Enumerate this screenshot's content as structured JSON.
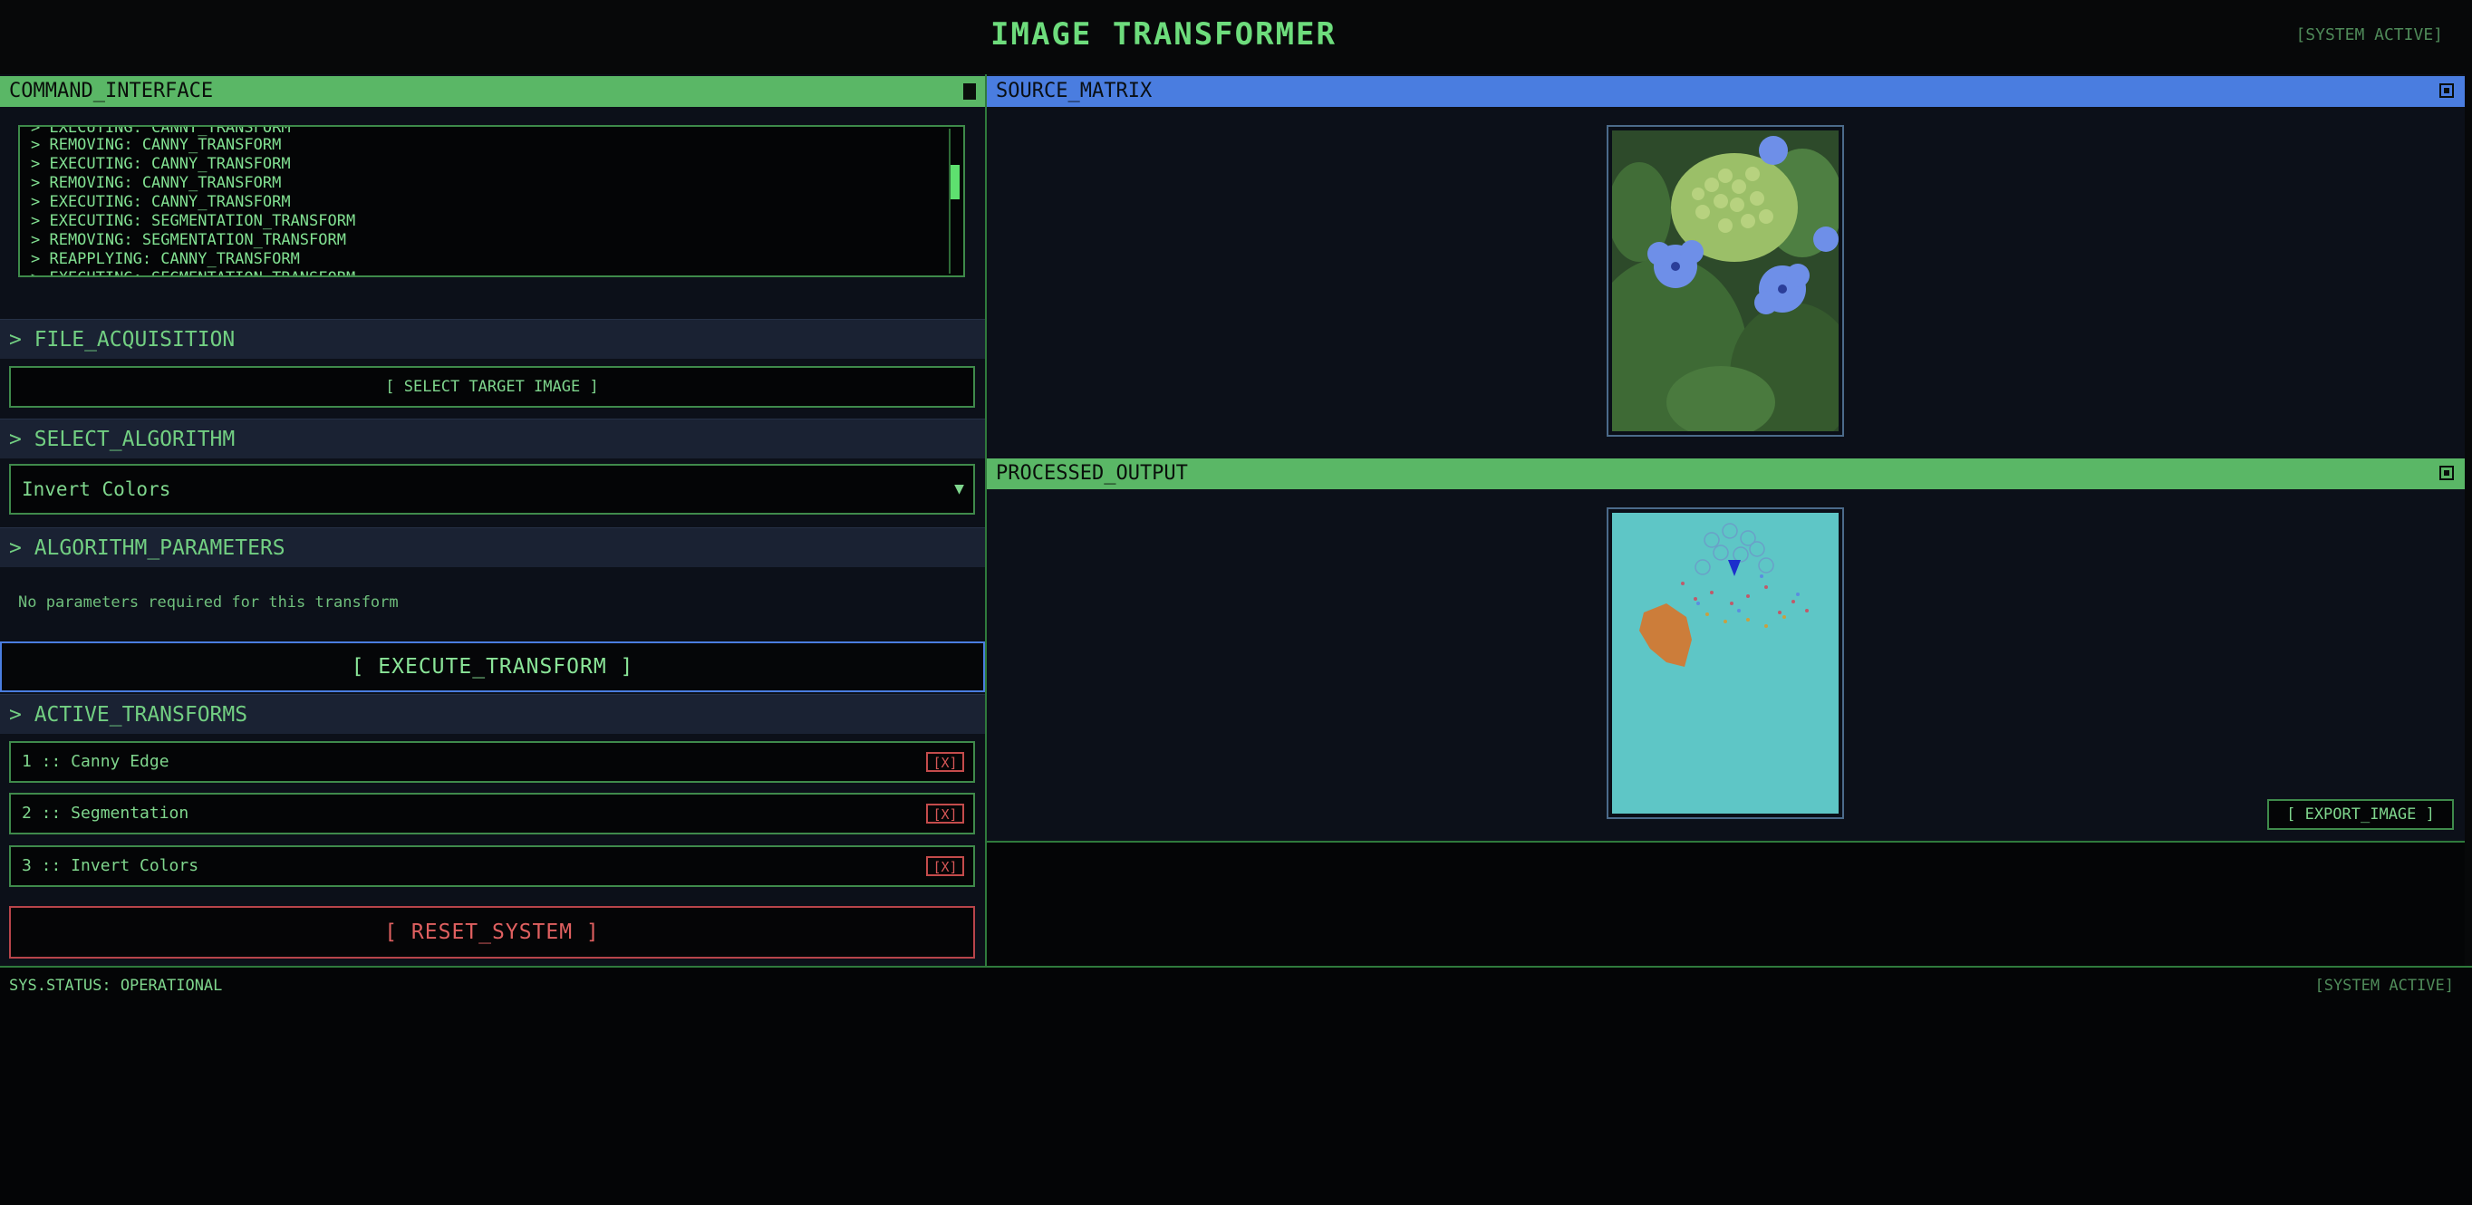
{
  "app": {
    "title": "IMAGE TRANSFORMER",
    "system_state": "[SYSTEM ACTIVE]"
  },
  "command_interface": {
    "title": "COMMAND_INTERFACE",
    "log": [
      "> EXECUTING: CANNY_TRANSFORM",
      "> REMOVING: CANNY_TRANSFORM",
      "> EXECUTING: CANNY_TRANSFORM",
      "> REMOVING: CANNY_TRANSFORM",
      "> EXECUTING: CANNY_TRANSFORM",
      "> EXECUTING: SEGMENTATION_TRANSFORM",
      "> REMOVING: SEGMENTATION_TRANSFORM",
      "> REAPPLYING: CANNY_TRANSFORM",
      "> EXECUTING: SEGMENTATION_TRANSFORM"
    ]
  },
  "file_acquisition": {
    "heading": "> FILE_ACQUISITION",
    "button": "[ SELECT TARGET IMAGE ]"
  },
  "algorithm": {
    "heading": "> SELECT_ALGORITHM",
    "selected": "Invert Colors"
  },
  "parameters": {
    "heading": "> ALGORITHM_PARAMETERS",
    "message": "No parameters required for this transform"
  },
  "execute": {
    "label": "[ EXECUTE_TRANSFORM ]"
  },
  "active_transforms": {
    "heading": "> ACTIVE_TRANSFORMS",
    "items": [
      {
        "label": "1 :: Canny Edge",
        "remove": "[X]"
      },
      {
        "label": "2 :: Segmentation",
        "remove": "[X]"
      },
      {
        "label": "3 :: Invert Colors",
        "remove": "[X]"
      }
    ]
  },
  "reset": {
    "label": "[ RESET_SYSTEM ]"
  },
  "source_matrix": {
    "title": "SOURCE_MATRIX"
  },
  "processed_output": {
    "title": "PROCESSED_OUTPUT",
    "export": "[ EXPORT_IMAGE ]"
  },
  "status": {
    "left": "SYS.STATUS: OPERATIONAL",
    "right": "[SYSTEM ACTIVE]"
  },
  "colors": {
    "accent_green": "#5ab766",
    "accent_blue": "#4a7de0",
    "danger": "#d55656",
    "background": "#070809"
  }
}
